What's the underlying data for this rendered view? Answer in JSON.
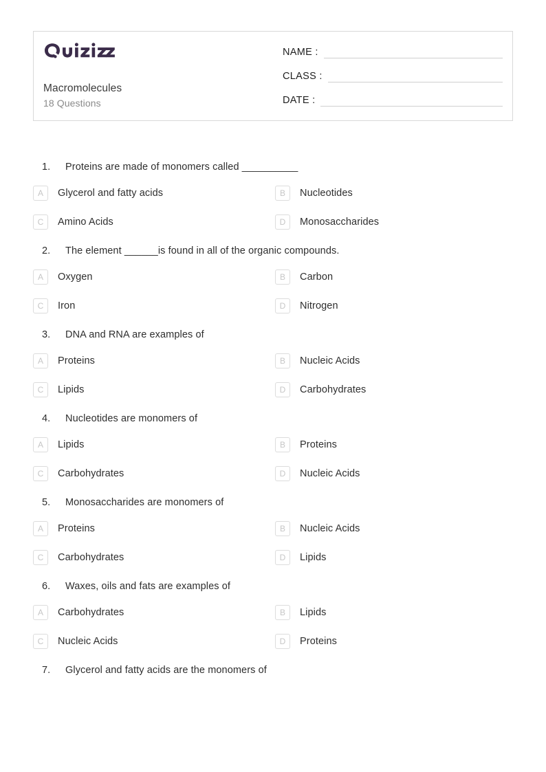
{
  "header": {
    "logo_text": "Quizizz",
    "logo_icon": "quizizz-logo",
    "logo_color": "#3B2C4A",
    "quiz_title": "Macromolecules",
    "question_count_label": "18 Questions",
    "fields": [
      {
        "label": "NAME :",
        "value": ""
      },
      {
        "label": "CLASS :",
        "value": ""
      },
      {
        "label": "DATE  :",
        "value": ""
      }
    ]
  },
  "questions": [
    {
      "number": "1.",
      "text": "Proteins are made of monomers called __________",
      "options": [
        {
          "letter": "A",
          "text": "Glycerol and fatty acids"
        },
        {
          "letter": "B",
          "text": "Nucleotides"
        },
        {
          "letter": "C",
          "text": "Amino Acids"
        },
        {
          "letter": "D",
          "text": "Monosaccharides"
        }
      ]
    },
    {
      "number": "2.",
      "text": "The element ______is found in all of the organic compounds.",
      "options": [
        {
          "letter": "A",
          "text": "Oxygen"
        },
        {
          "letter": "B",
          "text": "Carbon"
        },
        {
          "letter": "C",
          "text": "Iron"
        },
        {
          "letter": "D",
          "text": "Nitrogen"
        }
      ]
    },
    {
      "number": "3.",
      "text": "DNA and RNA are examples of",
      "options": [
        {
          "letter": "A",
          "text": "Proteins"
        },
        {
          "letter": "B",
          "text": "Nucleic Acids"
        },
        {
          "letter": "C",
          "text": "Lipids"
        },
        {
          "letter": "D",
          "text": "Carbohydrates"
        }
      ]
    },
    {
      "number": "4.",
      "text": "Nucleotides are monomers of",
      "options": [
        {
          "letter": "A",
          "text": "Lipids"
        },
        {
          "letter": "B",
          "text": "Proteins"
        },
        {
          "letter": "C",
          "text": "Carbohydrates"
        },
        {
          "letter": "D",
          "text": "Nucleic Acids"
        }
      ]
    },
    {
      "number": "5.",
      "text": "Monosaccharides are monomers of",
      "options": [
        {
          "letter": "A",
          "text": "Proteins"
        },
        {
          "letter": "B",
          "text": "Nucleic Acids"
        },
        {
          "letter": "C",
          "text": "Carbohydrates"
        },
        {
          "letter": "D",
          "text": "Lipids"
        }
      ]
    },
    {
      "number": "6.",
      "text": "Waxes, oils and fats are examples of",
      "options": [
        {
          "letter": "A",
          "text": "Carbohydrates"
        },
        {
          "letter": "B",
          "text": "Lipids"
        },
        {
          "letter": "C",
          "text": "Nucleic Acids"
        },
        {
          "letter": "D",
          "text": "Proteins"
        }
      ]
    },
    {
      "number": "7.",
      "text": "Glycerol and fatty acids are the monomers of",
      "options": []
    }
  ]
}
